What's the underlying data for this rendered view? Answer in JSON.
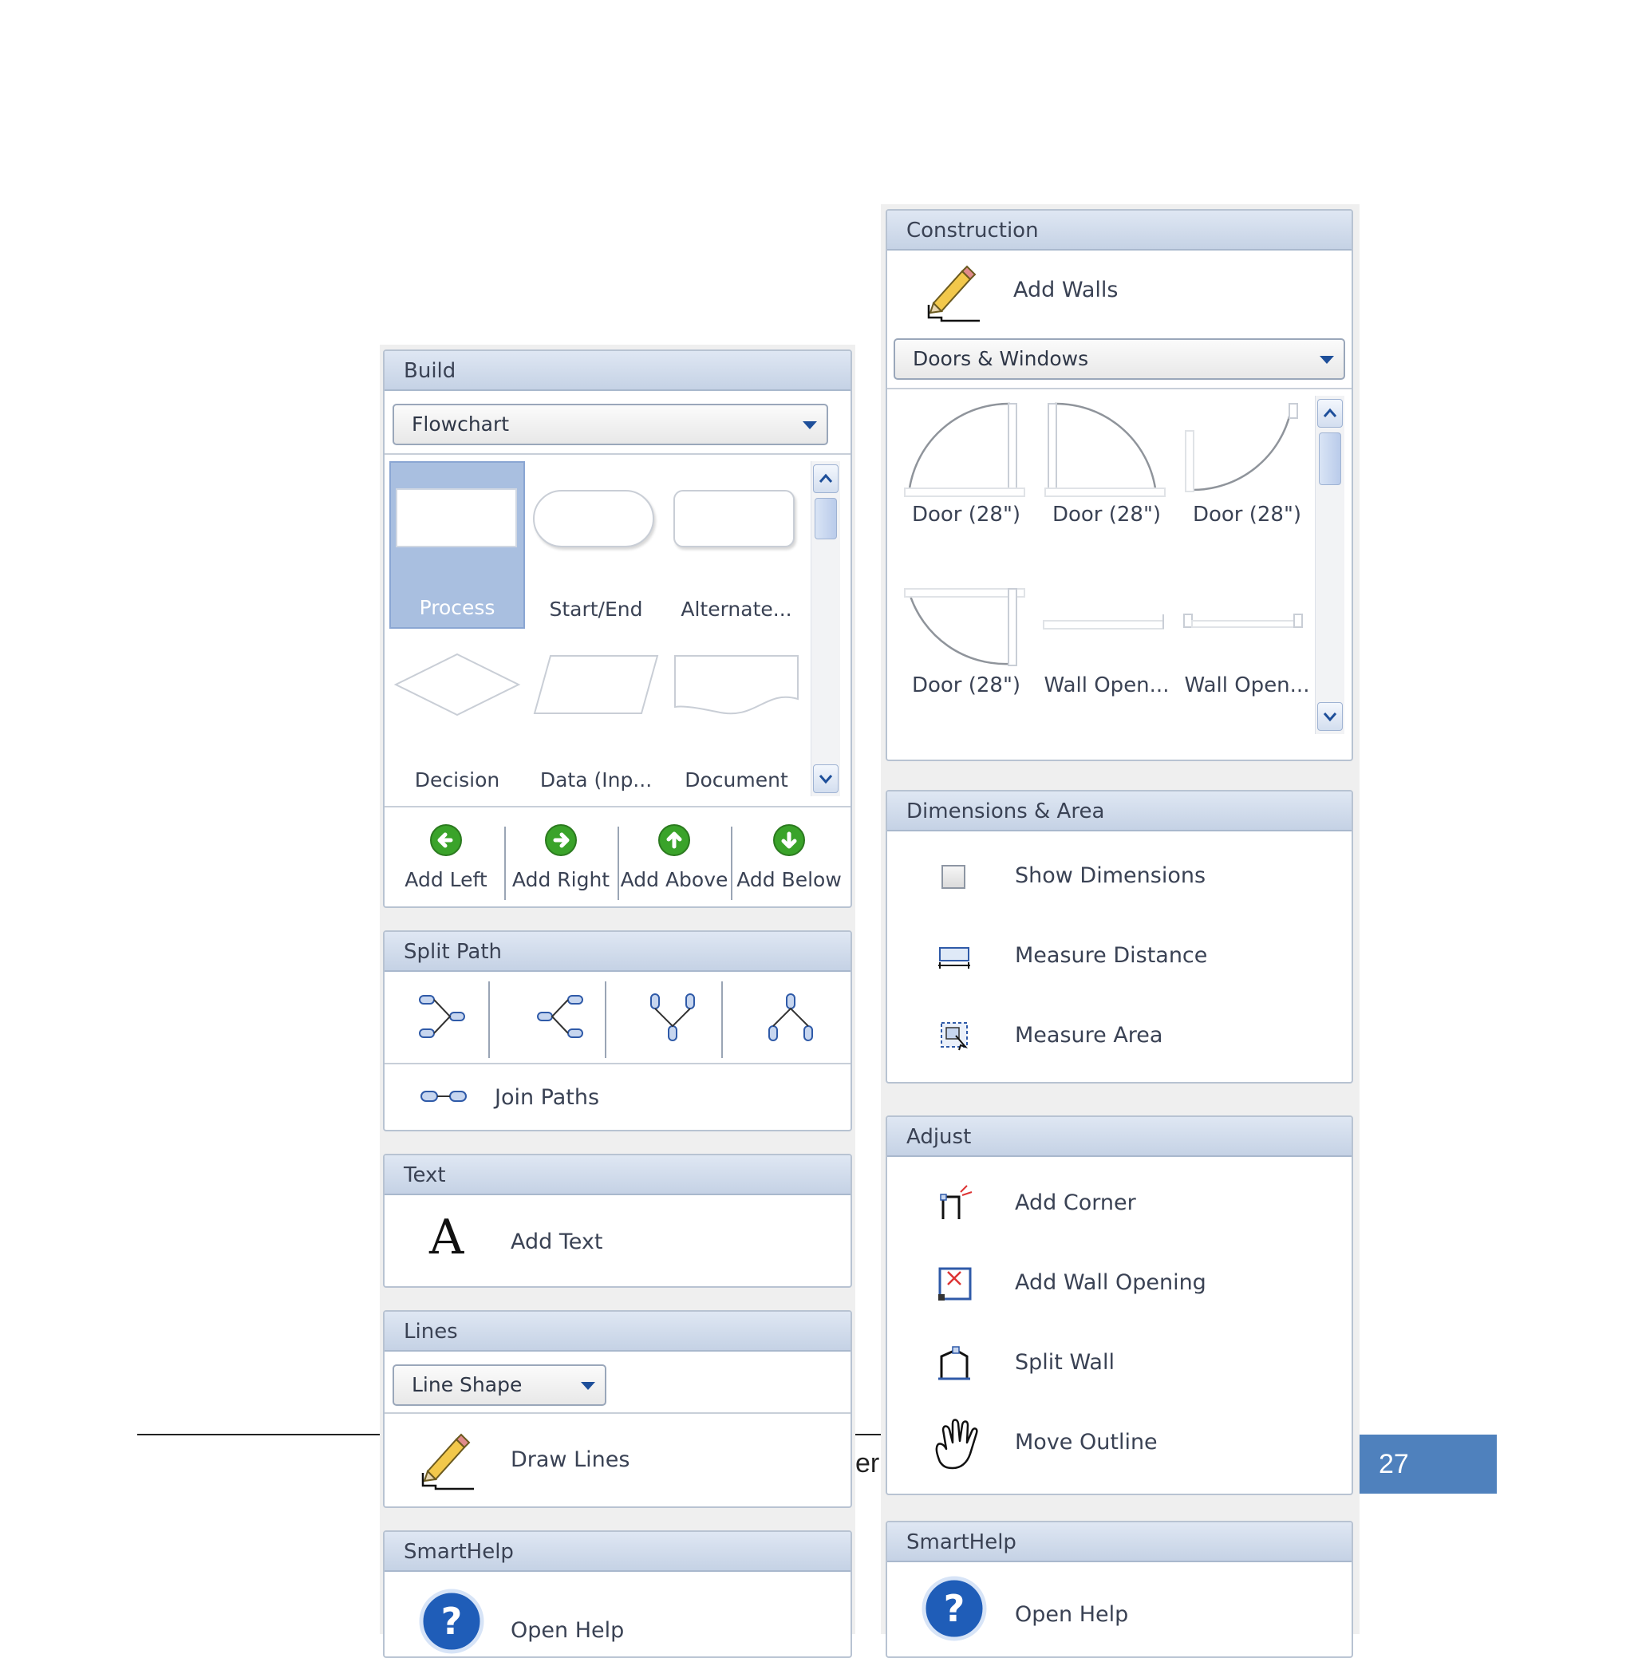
{
  "footer": {
    "page_number": "27",
    "fragment": "er"
  },
  "left": {
    "build": {
      "title": "Build",
      "dropdown": "Flowchart",
      "shapes": [
        "Process",
        "Start/End",
        "Alternate...",
        "Decision",
        "Data (Inp...",
        "Document"
      ],
      "add_buttons": [
        "Add Left",
        "Add Right",
        "Add Above",
        "Add Below"
      ]
    },
    "split_path": {
      "title": "Split Path",
      "join": "Join Paths"
    },
    "text": {
      "title": "Text",
      "add_text": "Add Text",
      "glyph": "A"
    },
    "lines": {
      "title": "Lines",
      "dropdown": "Line Shape",
      "draw": "Draw Lines"
    },
    "smarthelp": {
      "title": "SmartHelp",
      "open": "Open Help",
      "glyph": "?"
    }
  },
  "right": {
    "construction": {
      "title": "Construction",
      "add_walls": "Add Walls",
      "dropdown": "Doors & Windows",
      "items": [
        "Door (28\")",
        "Door (28\")",
        "Door (28\")",
        "Door (28\")",
        "Wall Open...",
        "Wall Open..."
      ]
    },
    "dimensions": {
      "title": "Dimensions & Area",
      "items": [
        "Show Dimensions",
        "Measure Distance",
        "Measure Area"
      ]
    },
    "adjust": {
      "title": "Adjust",
      "items": [
        "Add Corner",
        "Add Wall Opening",
        "Split Wall",
        "Move Outline"
      ]
    },
    "smarthelp": {
      "title": "SmartHelp",
      "open": "Open Help",
      "glyph": "?"
    }
  },
  "colors": {
    "accent": "#4f81bd",
    "header": "#c5d2e5",
    "green": "#3aa32a",
    "help_blue": "#1f5db8"
  }
}
